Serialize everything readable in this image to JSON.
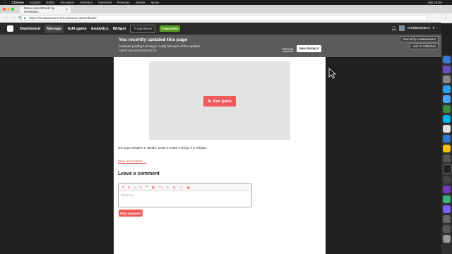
{
  "menubar": {
    "items": [
      "Chrome",
      "Arquivo",
      "Editar",
      "Visualizar",
      "Histórico",
      "Favoritos",
      "Pessoas",
      "Janela",
      "Ajuda"
    ],
    "clock": "sáb 16:58"
  },
  "browser": {
    "tab_title": "Naruo assombrado by renatanav...",
    "url": "https://renatanavarro.itch.io/naruo-assombrado"
  },
  "itch_nav": {
    "items": [
      "Dashboard",
      "Manage",
      "Edit game",
      "Analytics",
      "Widget"
    ],
    "edit_theme": "Edit theme",
    "published_badge": "PUBLISHED",
    "username": "renatanavarro"
  },
  "notice": {
    "title": "You recently updated this page",
    "line1": "Consider posting a devlog to notify followers of the updates.",
    "line2": "Added naruoassombrado.zip",
    "dismiss": "Dismiss",
    "new_devlog": "New devlog ▾",
    "view_all": "View all by renatanavarro",
    "add_to_collection": "Add To Collection"
  },
  "game": {
    "run_button": "Run game",
    "description": "Um jogo simples e rápido, onde o maior inimigo é o relógio.",
    "more_info": "More information →"
  },
  "comment": {
    "heading": "Leave a comment",
    "placeholder": "Required",
    "tools": [
      "¶",
      "B",
      "I",
      "S",
      "❝",
      "▦",
      "<>",
      "≡",
      "⊕",
      "▢",
      "▣"
    ],
    "post_button": "Post comment"
  },
  "colors": {
    "accent": "#f05a5a",
    "published": "#5aa020",
    "header_bg": "#2b2b2b",
    "notice_bg": "#5b5b5b"
  }
}
